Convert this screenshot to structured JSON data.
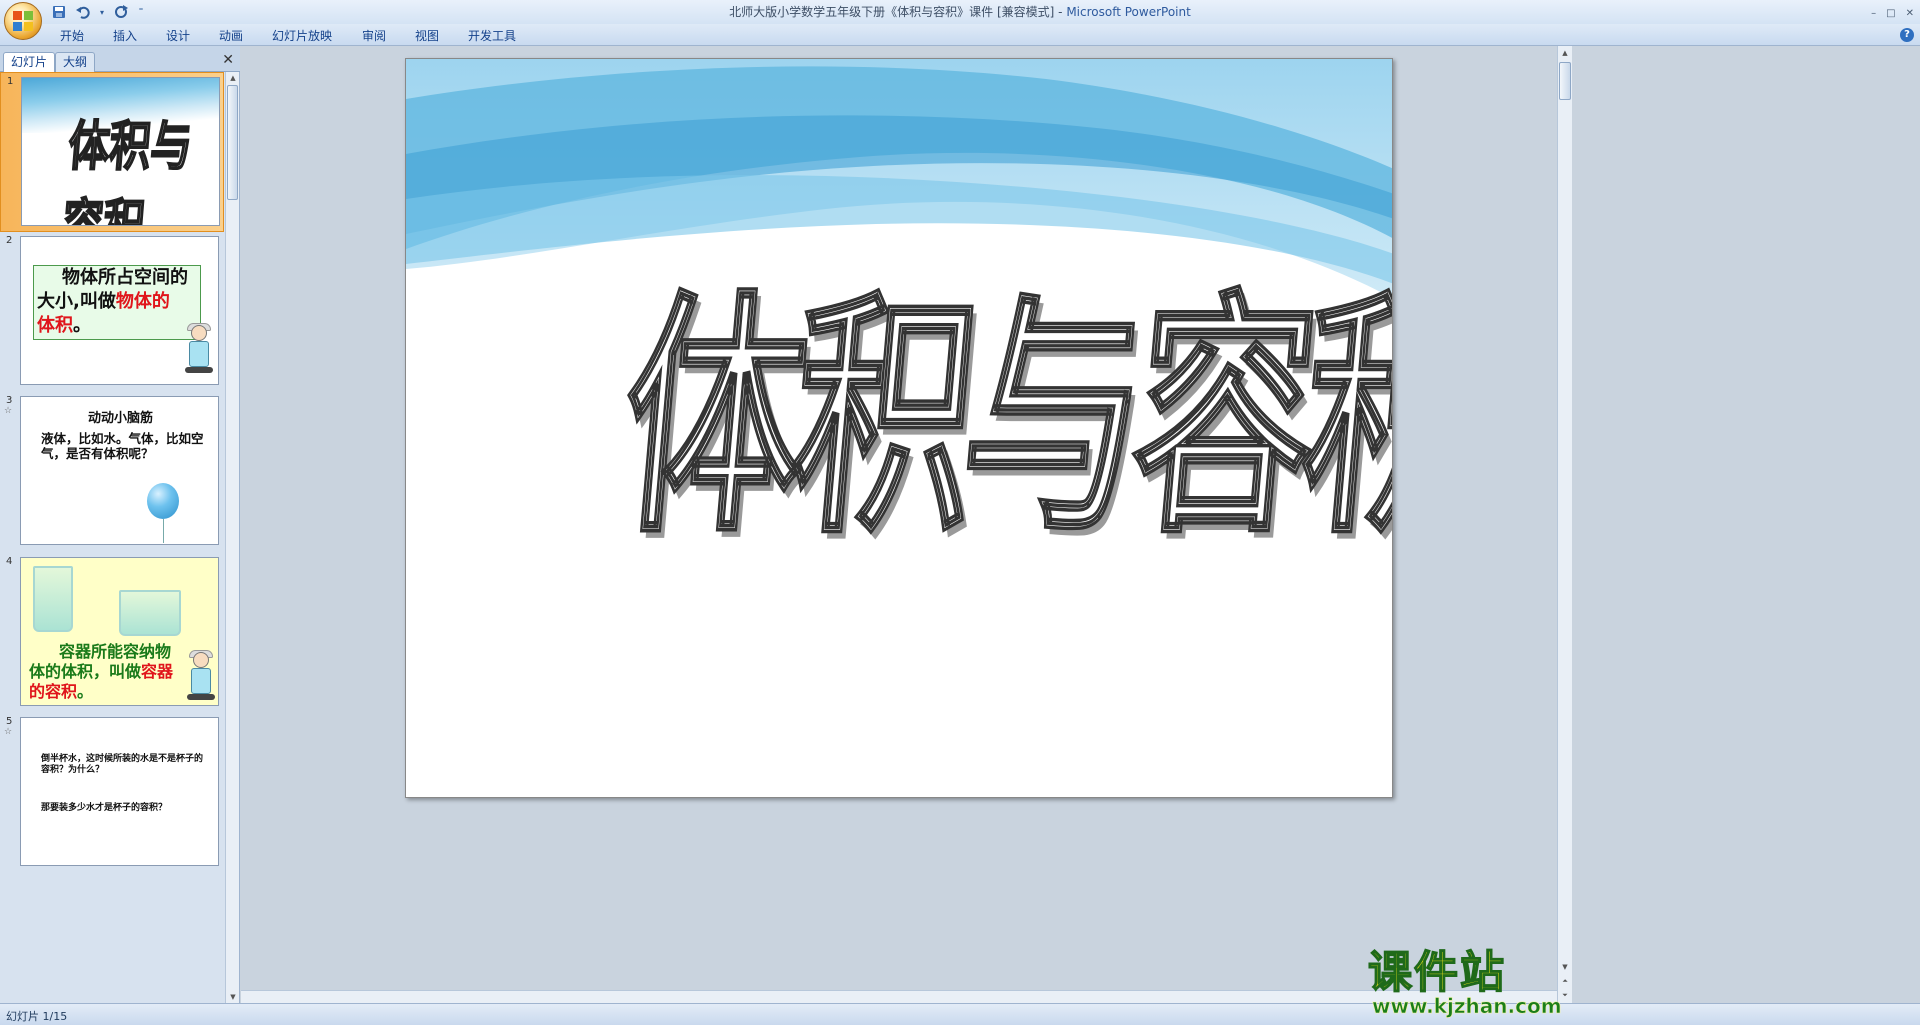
{
  "window": {
    "title_main": "北师大版小学数学五年级下册《体积与容积》课件 [兼容模式] - ",
    "title_app": "Microsoft PowerPoint",
    "controls": [
      "–",
      "□",
      "✕"
    ]
  },
  "qat": {
    "save_icon": "save-icon",
    "undo_icon": "undo-icon",
    "redo_icon": "redo-icon",
    "customize_icon": "dropdown-icon"
  },
  "menu": {
    "items": [
      "开始",
      "插入",
      "设计",
      "动画",
      "幻灯片放映",
      "审阅",
      "视图",
      "开发工具"
    ]
  },
  "pane": {
    "tab_slides": "幻灯片",
    "tab_outline": "大纲",
    "close": "✕"
  },
  "thumbs": [
    {
      "num": "1",
      "title": "体积与容积"
    },
    {
      "num": "2",
      "line1": "物体所占空间的",
      "line2a": "大小",
      "line2b": ",叫做",
      "line2c": "物体的",
      "line3a": "体积",
      "line3b": "。"
    },
    {
      "num": "3",
      "star": "☆",
      "heading": "动动小脑筋",
      "body": "液体，比如水。气体，比如空气，是否有体积呢？"
    },
    {
      "num": "4",
      "text_a": "容器所能容纳物体的体积，叫做",
      "text_b": "容器的容积",
      "text_c": "。"
    },
    {
      "num": "5",
      "star": "☆",
      "line_a": "倒半杯水，这时候所装的水是不是杯子的容积？为什么？",
      "line_b": "那要装多少水才是杯子的容积？"
    }
  ],
  "slide": {
    "title": "体积与容积"
  },
  "status": {
    "text": "幻灯片 1/15"
  },
  "watermark": {
    "title": "课件站",
    "url": "www.kjzhan.com"
  },
  "colors": {
    "accent_red": "#e0151b",
    "wave_blue": "#4da8d8",
    "title_outline": "#333333"
  }
}
